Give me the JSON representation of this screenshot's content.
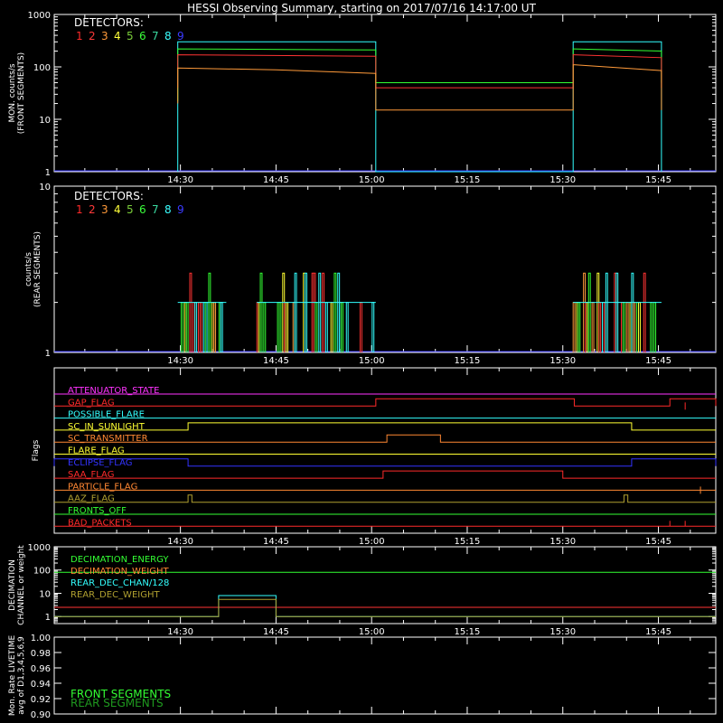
{
  "title": "HESSI Observing Summary, starting on 2017/07/16 14:17:00 UT",
  "colors": {
    "det": [
      "#ff2a2a",
      "#ff3a3a",
      "#ff9a3a",
      "#ffff3a",
      "#7acd3a",
      "#3aff3a",
      "#3ad9a0",
      "#3affff",
      "#3a3aff"
    ],
    "magenta": "#ff33ff",
    "red": "#ff2a2a",
    "cyan": "#33ffff",
    "yellow": "#ffff33",
    "orange": "#ff8833",
    "blue": "#3333ff",
    "green": "#33ff33",
    "olive": "#b0a030",
    "white": "#ffffff"
  },
  "x_ticks": [
    "14:30",
    "14:45",
    "15:00",
    "15:15",
    "15:30",
    "15:45"
  ],
  "chart_data": [
    {
      "type": "line",
      "name": "front",
      "ylabel": [
        "MON. counts/s",
        "(FRONT SEGMENTS)"
      ],
      "ylog": true,
      "ylim": [
        1,
        1000
      ],
      "yticks": [
        {
          "v": 1,
          "t": "1"
        },
        {
          "v": 10,
          "t": "10"
        },
        {
          "v": 100,
          "t": "100"
        },
        {
          "v": 1000,
          "t": "1000"
        }
      ],
      "legend_title": "DETECTORS:",
      "legend_nums": [
        "1",
        "2",
        "3",
        "4",
        "5",
        "6",
        "7",
        "8",
        "9"
      ],
      "series": [
        {
          "color": "#33ffff",
          "points": [
            [
              14.493,
              1
            ],
            [
              14.493,
              300
            ],
            [
              15.011,
              300
            ],
            [
              15.011,
              1
            ],
            [
              15.527,
              1
            ],
            [
              15.527,
              300
            ],
            [
              15.758,
              300
            ],
            [
              15.758,
              1
            ]
          ]
        },
        {
          "color": "#33ff33",
          "points": [
            [
              14.493,
              22
            ],
            [
              14.493,
              220
            ],
            [
              15.011,
              210
            ],
            [
              15.011,
              50
            ],
            [
              15.527,
              50
            ],
            [
              15.527,
              220
            ],
            [
              15.758,
              200
            ],
            [
              15.758,
              50
            ]
          ]
        },
        {
          "color": "#ff3333",
          "points": [
            [
              14.493,
              40
            ],
            [
              14.493,
              170
            ],
            [
              15.011,
              160
            ],
            [
              15.011,
              40
            ],
            [
              15.527,
              40
            ],
            [
              15.527,
              170
            ],
            [
              15.758,
              150
            ],
            [
              15.758,
              40
            ]
          ]
        },
        {
          "color": "#ff9a3a",
          "points": [
            [
              14.493,
              20
            ],
            [
              14.493,
              95
            ],
            [
              14.75,
              88
            ],
            [
              15.011,
              75
            ],
            [
              15.011,
              15
            ],
            [
              15.527,
              15
            ],
            [
              15.527,
              110
            ],
            [
              15.758,
              85
            ],
            [
              15.758,
              15
            ]
          ]
        }
      ]
    },
    {
      "type": "line",
      "name": "rear",
      "ylabel": [
        "counts/s",
        "(REAR SEGMENTS)"
      ],
      "ylog": true,
      "ylim": [
        1,
        10
      ],
      "yticks": [
        {
          "v": 1,
          "t": "1"
        },
        {
          "v": 10,
          "t": "10"
        }
      ],
      "legend_title": "DETECTORS:",
      "legend_nums": [
        "1",
        "2",
        "3",
        "4",
        "5",
        "6",
        "7",
        "8",
        "9"
      ],
      "intervals": [
        [
          14.493,
          14.62
        ],
        [
          14.7,
          15.011
        ],
        [
          15.527,
          15.758
        ]
      ]
    },
    {
      "type": "line",
      "name": "flags",
      "ylabel": [
        "Flags"
      ],
      "rows": [
        {
          "label": "ATTENUATOR_STATE",
          "color": "#ff33ff",
          "segments": []
        },
        {
          "label": "GAP_FLAG",
          "color": "#ff2a2a",
          "segments": [
            [
              15.011,
              15.53
            ],
            [
              15.78,
              15.9
            ]
          ]
        },
        {
          "label": "POSSIBLE_FLARE",
          "color": "#33ffff",
          "segments": []
        },
        {
          "label": "SC_IN_SUNLIGHT",
          "color": "#ffff33",
          "segments": [
            [
              14.52,
              15.68
            ]
          ]
        },
        {
          "label": "SC_TRANSMITTER",
          "color": "#ff8833",
          "segments": [
            [
              15.04,
              15.18
            ]
          ]
        },
        {
          "label": "FLARE_FLAG",
          "color": "#ffff33",
          "segments": []
        },
        {
          "label": "ECLIPSE_FLAG",
          "color": "#3333ff",
          "segments": [
            [
              14.17,
              14.52
            ],
            [
              15.68,
              15.9
            ]
          ]
        },
        {
          "label": "SAA_FLAG",
          "color": "#ff2a2a",
          "segments": [
            [
              15.03,
              15.5
            ]
          ]
        },
        {
          "label": "PARTICLE_FLAG",
          "color": "#ff8833",
          "segments": []
        },
        {
          "label": "AAZ_FLAG",
          "color": "#b0a030",
          "segments": [
            [
              14.52,
              14.53
            ],
            [
              15.66,
              15.67
            ]
          ]
        },
        {
          "label": "FRONTS_OFF",
          "color": "#33ff33",
          "segments": []
        },
        {
          "label": "BAD_PACKETS",
          "color": "#ff2a2a",
          "segments": []
        }
      ]
    },
    {
      "type": "line",
      "name": "decimation",
      "ylabel": [
        "DECIMATION",
        "CHANNEL or weight"
      ],
      "ylog": true,
      "ylim": [
        0.5,
        1000
      ],
      "yticks": [
        {
          "v": 1,
          "t": "1"
        },
        {
          "v": 10,
          "t": "10"
        },
        {
          "v": 100,
          "t": "100"
        },
        {
          "v": 1000,
          "t": "1000"
        }
      ],
      "legend": [
        {
          "label": "DECIMATION_ENERGY",
          "color": "#33ff33"
        },
        {
          "label": "DECIMATION_WEIGHT",
          "color": "#ff8833"
        },
        {
          "label": "REAR_DEC_CHAN/128",
          "color": "#33ffff"
        },
        {
          "label": "REAR_DEC_WEIGHT",
          "color": "#b0a030"
        }
      ],
      "series": [
        {
          "color": "#33ff33",
          "points": [
            [
              14.17,
              80
            ],
            [
              15.9,
              80
            ]
          ]
        },
        {
          "color": "#ff3333",
          "points": [
            [
              14.17,
              2.5
            ],
            [
              15.9,
              2.5
            ]
          ]
        },
        {
          "color": "#33ffff",
          "points": [
            [
              14.17,
              1
            ],
            [
              14.6,
              1
            ],
            [
              14.6,
              8
            ],
            [
              14.75,
              8
            ],
            [
              14.75,
              1
            ],
            [
              15.9,
              1
            ]
          ]
        },
        {
          "color": "#b0a030",
          "points": [
            [
              14.17,
              1
            ],
            [
              14.6,
              1
            ],
            [
              14.6,
              5.5
            ],
            [
              14.75,
              5.5
            ],
            [
              14.75,
              1
            ],
            [
              15.9,
              1
            ]
          ]
        }
      ]
    },
    {
      "type": "line",
      "name": "livetime",
      "ylabel": [
        "Mon. Rate LIVETIME",
        "avg of D1,3,4,5,6,9"
      ],
      "ylim": [
        0.9,
        1.0
      ],
      "yticks": [
        {
          "v": 0.9,
          "t": "0.90"
        },
        {
          "v": 0.92,
          "t": "0.92"
        },
        {
          "v": 0.94,
          "t": "0.94"
        },
        {
          "v": 0.96,
          "t": "0.96"
        },
        {
          "v": 0.98,
          "t": "0.98"
        },
        {
          "v": 1.0,
          "t": "1.00"
        }
      ],
      "legend": [
        {
          "label": "FRONT SEGMENTS",
          "color": "#33ff33"
        },
        {
          "label": "REAR SEGMENTS",
          "color": "#1f9a1f"
        }
      ]
    }
  ]
}
